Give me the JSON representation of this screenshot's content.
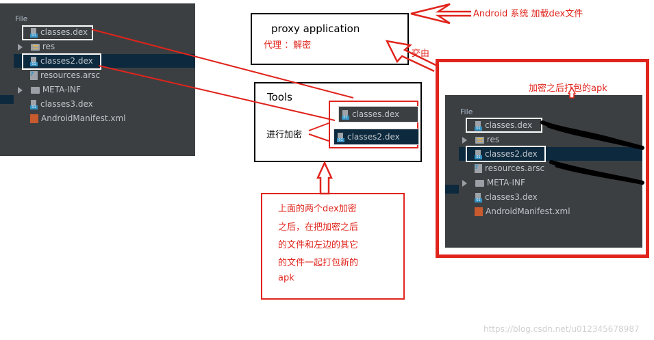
{
  "left_panel": {
    "header": "File",
    "items": [
      {
        "label": "classes.dex",
        "icon": "dex-file-icon"
      },
      {
        "label": "res",
        "icon": "res-folder-icon"
      },
      {
        "label": "classes2.dex",
        "icon": "dex-file-icon"
      },
      {
        "label": "resources.arsc",
        "icon": "arsc-file-icon"
      },
      {
        "label": "META-INF",
        "icon": "folder-icon"
      },
      {
        "label": "classes3.dex",
        "icon": "dex-file-icon"
      },
      {
        "label": "AndroidManifest.xml",
        "icon": "xml-file-icon"
      }
    ]
  },
  "proxy_box": {
    "title": "proxy application",
    "subtitle": "代理 ：解密"
  },
  "android_label": "Android 系统 加载dex文件",
  "handover_label": "交由",
  "tools_box": {
    "title": "Tools",
    "encrypt_label": "进行加密",
    "file1": "classes.dex",
    "file2": "classes2.dex"
  },
  "note_box": {
    "lines": [
      "上面的两个dex加密",
      "之后，在把加密之后",
      "的文件和左边的其它",
      "的文件一起打包新的",
      "apk"
    ]
  },
  "apk_box": {
    "title": "加密之后打包的apk",
    "header": "File",
    "items": [
      {
        "label": "classes.dex",
        "icon": "dex-file-icon"
      },
      {
        "label": "res",
        "icon": "res-folder-icon"
      },
      {
        "label": "classes2.dex",
        "icon": "dex-file-icon"
      },
      {
        "label": "resources.arsc",
        "icon": "arsc-file-icon"
      },
      {
        "label": "META-INF",
        "icon": "folder-icon"
      },
      {
        "label": "classes3.dex",
        "icon": "dex-file-icon"
      },
      {
        "label": "AndroidManifest.xml",
        "icon": "xml-file-icon"
      }
    ]
  },
  "watermark": "https://blog.csdn.net/u012345678987"
}
